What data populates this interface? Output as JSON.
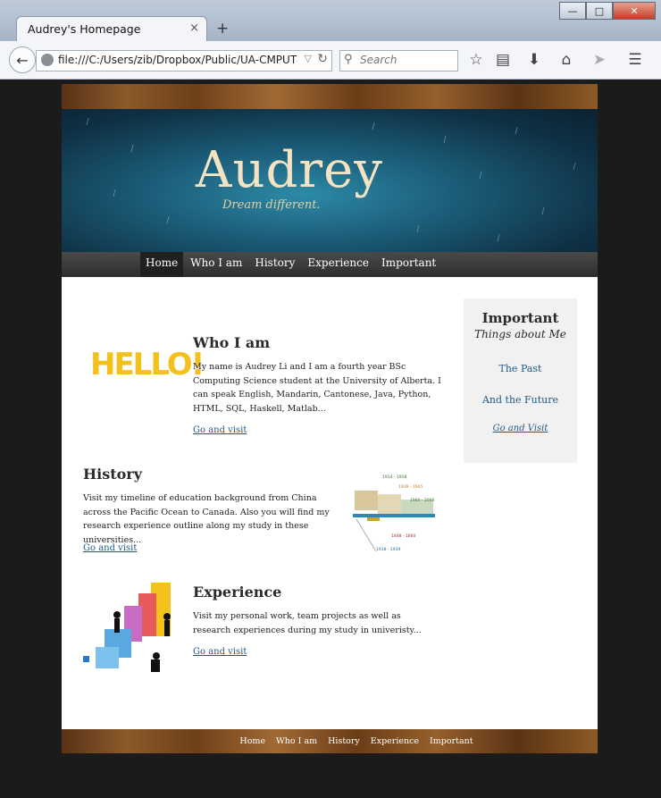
{
  "browser": {
    "tab_title": "Audrey's Homepage",
    "tab_close": "×",
    "new_tab": "+",
    "url": "file:///C:/Users/zib/Dropbox/Public/UA-CMPUT410/",
    "search_placeholder": "Search",
    "window_controls": {
      "minimize": "—",
      "maximize": "□",
      "close": "✕"
    }
  },
  "header": {
    "title": "Audrey",
    "tagline": "Dream different."
  },
  "nav": {
    "items": [
      "Home",
      "Who I am",
      "History",
      "Experience",
      "Important"
    ],
    "active": "Home"
  },
  "sections": {
    "who": {
      "image_text": "HELLO!",
      "title": "Who I am",
      "body": "My name is Audrey Li and I am a fourth year BSc Computing Science student at the University of Alberta. I can speak English, Mandarin, Cantonese, Java, Python, HTML, SQL, Haskell, Matlab...",
      "link": "Go and visit"
    },
    "history": {
      "title": "History",
      "body": "Visit my timeline of education background from China across the Pacific Ocean to Canada. Also you will find my research experience outline along my study in these universities...",
      "link": "Go and visit",
      "timeline_labels": [
        "1914 - 1918",
        "1939 - 1945",
        "1960 - 2000",
        "1848 - 1860",
        "1918 - 1939"
      ]
    },
    "experience": {
      "title": "Experience",
      "body": "Visit my personal work, team projects as well as research experiences during my study in univeristy...",
      "link": "Go and visit"
    }
  },
  "sidebar": {
    "title": "Important",
    "subtitle": "Things about Me",
    "links": [
      "The Past",
      "And the Future"
    ],
    "go_link": "Go and Visit"
  },
  "footer": {
    "items": [
      "Home",
      "Who I am",
      "History",
      "Experience",
      "Important"
    ]
  },
  "colors": {
    "page_bg": "#1b1b1b",
    "link": "#1f5a86",
    "hello_yellow": "#f3c11b",
    "menu_bar": "#2e2e2e",
    "banner": "#1c5f7b"
  }
}
